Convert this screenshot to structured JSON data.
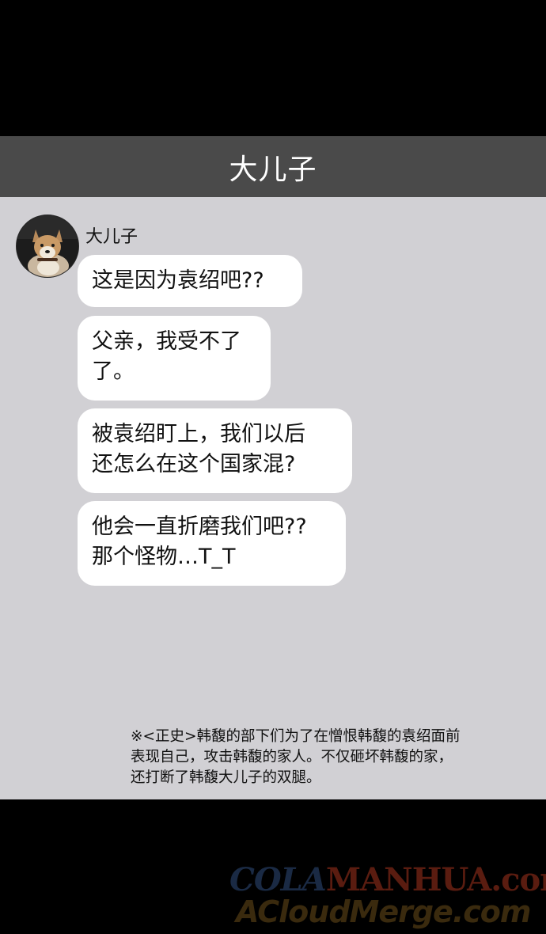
{
  "header": {
    "title": "大儿子"
  },
  "contact": {
    "name": "大儿子",
    "avatar_icon": "shiba-dog-avatar"
  },
  "messages": [
    {
      "text": "这是因为袁绍吧??"
    },
    {
      "text": "父亲，我受不了\n了。"
    },
    {
      "text": "被袁绍盯上，我们以后\n还怎么在这个国家混?"
    },
    {
      "text": "他会一直折磨我们吧??\n那个怪物…T_T"
    }
  ],
  "footnote": "※<正史>韩馥的部下们为了在憎恨韩馥的袁绍面前\n表现自己，攻击韩馥的家人。不仅砸坏韩馥的家，\n还打断了韩馥大儿子的双腿。",
  "watermark": {
    "cola": "COLA",
    "manhua": "MANHUA",
    "com": ".com",
    "line2": "ACloudMerge.com"
  },
  "colors": {
    "header_bg": "#4a4a4a",
    "chat_bg": "#d1d0d4",
    "bubble_bg": "#ffffff"
  }
}
